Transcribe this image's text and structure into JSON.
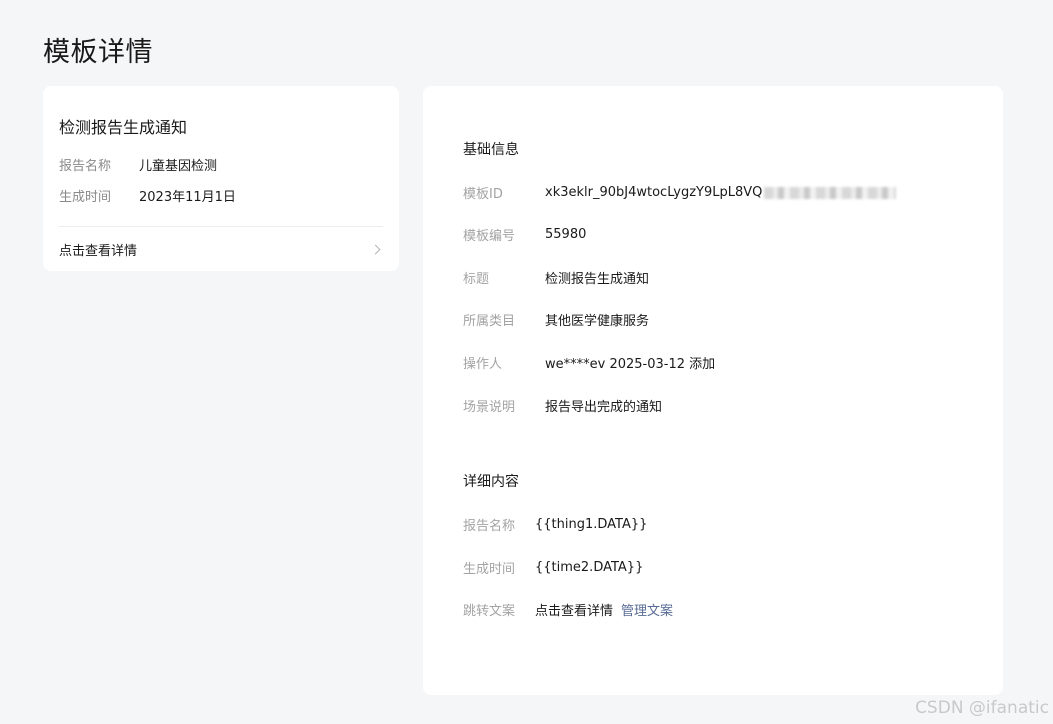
{
  "page": {
    "title": "模板详情"
  },
  "preview": {
    "title": "检测报告生成通知",
    "rows": [
      {
        "label": "报告名称",
        "value": "儿童基因检测"
      },
      {
        "label": "生成时间",
        "value": "2023年11月1日"
      }
    ],
    "link_label": "点击查看详情"
  },
  "basic_info": {
    "title": "基础信息",
    "template_id": {
      "label": "模板ID",
      "value": "xk3eklr_90bJ4wtocLygzY9LpL8VQ"
    },
    "template_no": {
      "label": "模板编号",
      "value": "55980"
    },
    "subject": {
      "label": "标题",
      "value": "检测报告生成通知"
    },
    "category": {
      "label": "所属类目",
      "value": "其他医学健康服务"
    },
    "operator": {
      "label": "操作人",
      "value": "we****ev 2025-03-12 添加"
    },
    "scene": {
      "label": "场景说明",
      "value": "报告导出完成的通知"
    }
  },
  "detail_content": {
    "title": "详细内容",
    "rows": [
      {
        "label": "报告名称",
        "value": "{{thing1.DATA}}"
      },
      {
        "label": "生成时间",
        "value": "{{time2.DATA}}"
      }
    ],
    "jump": {
      "label": "跳转文案",
      "value": "点击查看详情",
      "link": "管理文案"
    }
  },
  "watermark": "CSDN @ifanatic",
  "colors": {
    "background": "#f5f6f8",
    "card": "#ffffff",
    "link": "#576b95",
    "muted_label": "#a3a3a3"
  }
}
